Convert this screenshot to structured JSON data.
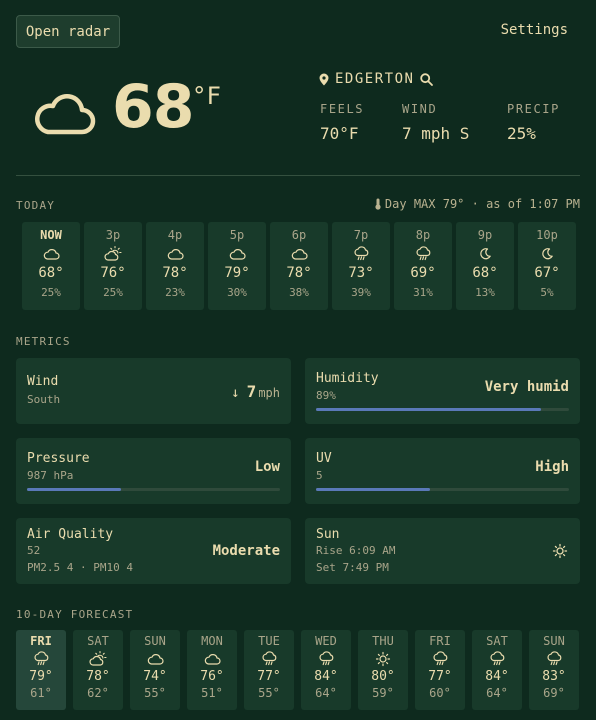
{
  "header": {
    "radar_button": "Open radar",
    "settings_link": "Settings"
  },
  "current": {
    "temperature": "68",
    "unit": "°F",
    "condition_icon": "cloud-icon",
    "location": "EDGERTON",
    "stats": [
      {
        "label": "FEELS",
        "value": "70°F"
      },
      {
        "label": "WIND",
        "value": "7 mph S"
      },
      {
        "label": "PRECIP",
        "value": "25%"
      }
    ]
  },
  "today": {
    "section_label": "TODAY",
    "meta": "Day MAX 79° · as of 1:07 PM",
    "hours": [
      {
        "time": "NOW",
        "icon": "cloud",
        "temp": "68°",
        "pop": "25%"
      },
      {
        "time": "3p",
        "icon": "partly-sunny",
        "temp": "76°",
        "pop": "25%"
      },
      {
        "time": "4p",
        "icon": "cloud",
        "temp": "78°",
        "pop": "23%"
      },
      {
        "time": "5p",
        "icon": "cloud",
        "temp": "79°",
        "pop": "30%"
      },
      {
        "time": "6p",
        "icon": "cloud",
        "temp": "78°",
        "pop": "38%"
      },
      {
        "time": "7p",
        "icon": "rain",
        "temp": "73°",
        "pop": "39%"
      },
      {
        "time": "8p",
        "icon": "rain",
        "temp": "69°",
        "pop": "31%"
      },
      {
        "time": "9p",
        "icon": "moon",
        "temp": "68°",
        "pop": "13%"
      },
      {
        "time": "10p",
        "icon": "moon",
        "temp": "67°",
        "pop": "5%"
      }
    ]
  },
  "metrics": {
    "section_label": "METRICS",
    "wind": {
      "title": "Wind",
      "direction": "South",
      "arrow": "↓",
      "speed": "7",
      "unit": "mph"
    },
    "humidity": {
      "title": "Humidity",
      "value": "89%",
      "level": "Very humid",
      "fraction": 0.89
    },
    "pressure": {
      "title": "Pressure",
      "value": "987 hPa",
      "level": "Low",
      "fraction": 0.37
    },
    "uv": {
      "title": "UV",
      "value": "5",
      "level": "High",
      "fraction": 0.45
    },
    "air_quality": {
      "title": "Air Quality",
      "value": "52",
      "detail": "PM2.5 4 · PM10 4",
      "level": "Moderate"
    },
    "sun": {
      "title": "Sun",
      "rise": "Rise 6:09 AM",
      "set": "Set 7:49 PM"
    }
  },
  "forecast": {
    "section_label": "10-DAY FORECAST",
    "days": [
      {
        "name": "FRI",
        "icon": "rain",
        "hi": "79°",
        "lo": "61°"
      },
      {
        "name": "SAT",
        "icon": "partly-sunny",
        "hi": "78°",
        "lo": "62°"
      },
      {
        "name": "SUN",
        "icon": "cloud",
        "hi": "74°",
        "lo": "55°"
      },
      {
        "name": "MON",
        "icon": "cloud",
        "hi": "76°",
        "lo": "51°"
      },
      {
        "name": "TUE",
        "icon": "rain",
        "hi": "77°",
        "lo": "55°"
      },
      {
        "name": "WED",
        "icon": "rain",
        "hi": "84°",
        "lo": "64°"
      },
      {
        "name": "THU",
        "icon": "sun",
        "hi": "80°",
        "lo": "59°"
      },
      {
        "name": "FRI",
        "icon": "rain",
        "hi": "77°",
        "lo": "60°"
      },
      {
        "name": "SAT",
        "icon": "rain",
        "hi": "84°",
        "lo": "64°"
      },
      {
        "name": "SUN",
        "icon": "rain",
        "hi": "83°",
        "lo": "69°"
      }
    ]
  },
  "colors": {
    "background": "#0e2a1e",
    "card": "#183a2a",
    "text": "#eadcae",
    "muted": "#a9a58a",
    "bar": "#5a79b8"
  }
}
